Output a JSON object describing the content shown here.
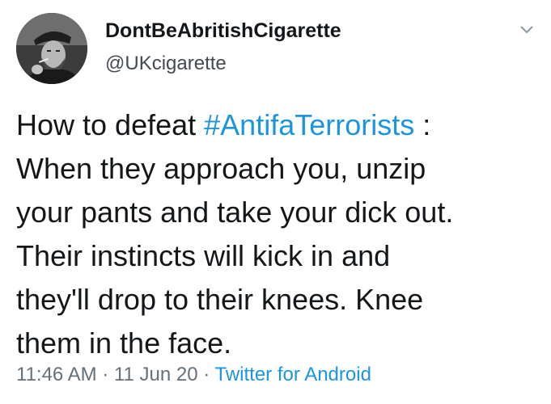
{
  "user": {
    "display_name": "DontBeAbritishCigarette",
    "handle": "@UKcigarette"
  },
  "tweet": {
    "lines": [
      {
        "before": "How to defeat ",
        "hashtag": "#AntifaTerrorists",
        "after": " :"
      },
      {
        "text": "When they approach you, unzip"
      },
      {
        "text": "your pants and take your dick out."
      },
      {
        "text": "Their instincts will kick in and"
      },
      {
        "text": "they'll drop to their knees. Knee"
      },
      {
        "text": "them in the face."
      }
    ]
  },
  "meta": {
    "time": "11:46 AM",
    "separator": " · ",
    "date": "11 Jun 20",
    "source": "Twitter for Android"
  },
  "icons": {
    "caret": "chevron-down-icon",
    "avatar": "profile-avatar"
  },
  "colors": {
    "link": "#1b95e0",
    "text": "#14171a",
    "muted": "#65707a"
  }
}
